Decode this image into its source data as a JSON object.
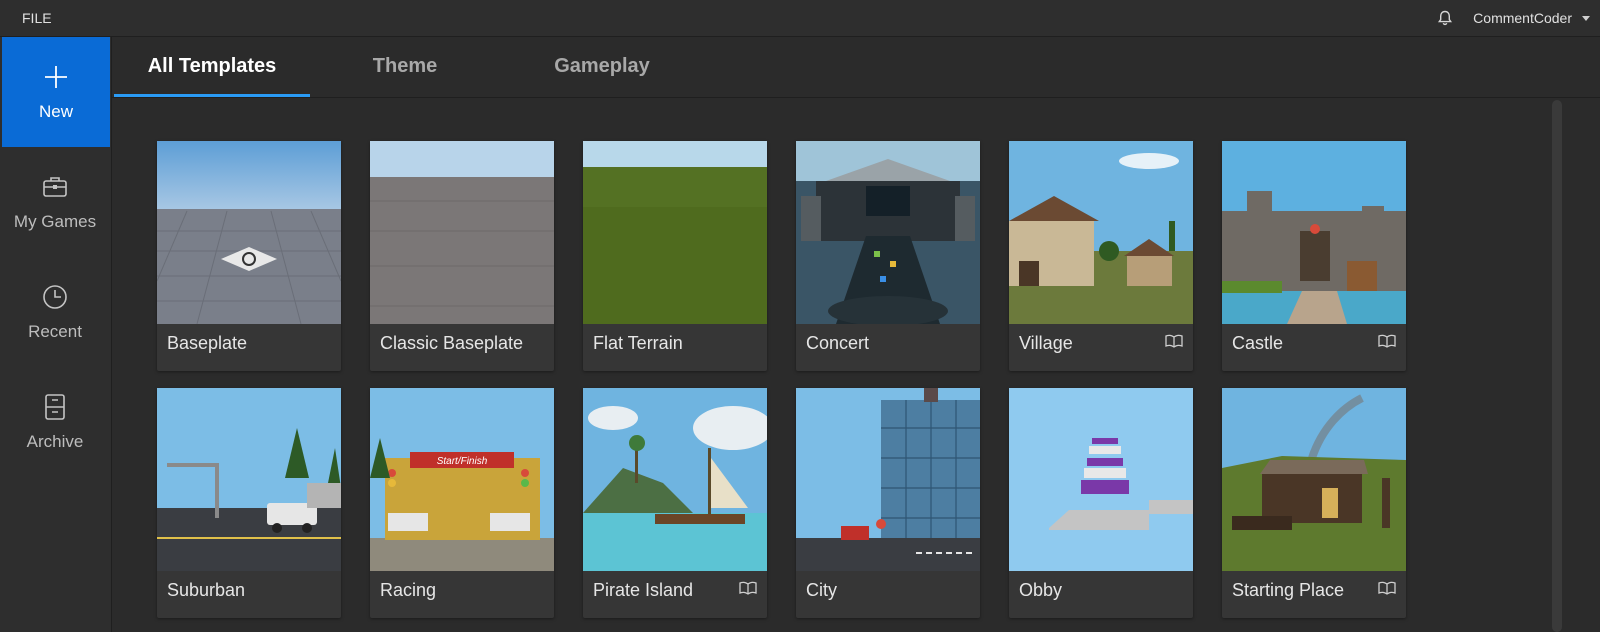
{
  "topbar": {
    "file_label": "FILE",
    "username": "CommentCoder",
    "bell_icon": "bell-icon"
  },
  "sidebar": {
    "items": [
      {
        "label": "New",
        "icon": "plus-icon",
        "active": true
      },
      {
        "label": "My Games",
        "icon": "briefcase-icon",
        "active": false
      },
      {
        "label": "Recent",
        "icon": "clock-icon",
        "active": false
      },
      {
        "label": "Archive",
        "icon": "archive-icon",
        "active": false
      }
    ]
  },
  "tabs": [
    {
      "label": "All Templates",
      "active": true
    },
    {
      "label": "Theme",
      "active": false
    },
    {
      "label": "Gameplay",
      "active": false
    }
  ],
  "templates": [
    {
      "name": "Baseplate",
      "tutorial": false
    },
    {
      "name": "Classic Baseplate",
      "tutorial": false
    },
    {
      "name": "Flat Terrain",
      "tutorial": false
    },
    {
      "name": "Concert",
      "tutorial": false
    },
    {
      "name": "Village",
      "tutorial": true
    },
    {
      "name": "Castle",
      "tutorial": true
    },
    {
      "name": "Suburban",
      "tutorial": false
    },
    {
      "name": "Racing",
      "tutorial": false
    },
    {
      "name": "Pirate Island",
      "tutorial": true
    },
    {
      "name": "City",
      "tutorial": false
    },
    {
      "name": "Obby",
      "tutorial": false
    },
    {
      "name": "Starting Place",
      "tutorial": true
    }
  ],
  "thumb_text": {
    "racing_banner": "Start/Finish"
  },
  "colors": {
    "accent": "#0a6bd6",
    "tab_underline": "#2a9bf5",
    "background": "#2b2b2b"
  }
}
